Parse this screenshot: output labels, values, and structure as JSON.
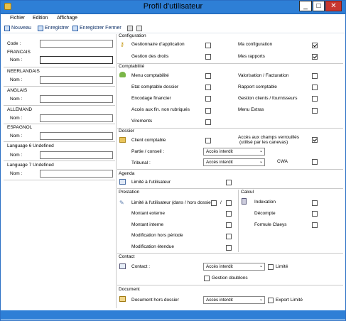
{
  "window": {
    "title": "Profil d'utilisateur",
    "controls": {
      "minimize": "_",
      "maximize": "□",
      "close": "✕"
    }
  },
  "menu": [
    "Fichier",
    "Edition",
    "Affichage"
  ],
  "toolbar": {
    "new": "Nouveau",
    "save": "Enregistrer",
    "save_close": "Enregistrer Fermer"
  },
  "left": {
    "code_label": "Code :",
    "code_value": "",
    "languages": [
      {
        "name": "FRANCAIS",
        "label": "Nom :",
        "value": ""
      },
      {
        "name": "NEERLANDAIS",
        "label": "Nom :",
        "value": ""
      },
      {
        "name": "ANGLAIS",
        "label": "Nom :",
        "value": ""
      },
      {
        "name": "ALLEMAND",
        "label": "Nom :",
        "value": ""
      },
      {
        "name": "ESPAGNOL",
        "label": "Nom :",
        "value": ""
      },
      {
        "name": "Language 6 Undefined",
        "label": "Nom :",
        "value": ""
      },
      {
        "name": "Language 7 Undefined",
        "label": "Nom :",
        "value": ""
      }
    ]
  },
  "configuration": {
    "title": "Configuration",
    "items": [
      {
        "label": "Gestionnaire d'application",
        "checked": false
      },
      {
        "label": "Gestion des droits",
        "checked": false
      },
      {
        "label": "Ma configuration",
        "checked": true
      },
      {
        "label": "Mes rapports",
        "checked": true
      }
    ]
  },
  "comptabilite": {
    "title": "Comptabilité",
    "items": [
      {
        "label": "Menu comptabilité",
        "checked": false
      },
      {
        "label": "Etat comptable dossier",
        "checked": false
      },
      {
        "label": "Encodage financier",
        "checked": false
      },
      {
        "label": "Accès aux fin. non rubriqués",
        "checked": false
      },
      {
        "label": "Virements",
        "checked": false
      },
      {
        "label": "Valorisation / Facturation",
        "checked": false
      },
      {
        "label": "Rapport comptable",
        "checked": false
      },
      {
        "label": "Gestion clients / fournisseurs",
        "checked": false
      },
      {
        "label": "Menu Extras",
        "checked": false
      }
    ]
  },
  "dossier": {
    "title": "Dossier",
    "client_label": "Client comptable",
    "client_checked": false,
    "partie_label": "Partie / conseil :",
    "partie_value": "Accès interdit",
    "tribunal_label": "Tribunal :",
    "tribunal_value": "Accès interdit",
    "verrouille_label": "Accès aux champs verrouillés",
    "verrouille_sub": "(utilisé par les canevas)",
    "verrouille_checked": true,
    "cwa_label": "CWA",
    "cwa_checked": false
  },
  "agenda": {
    "title": "Agenda",
    "label": "Limité à l'utilisateur",
    "checked": false
  },
  "prestation": {
    "title": "Prestation",
    "limite_label": "Limité à l'utilisateur (dans / hors dossier)",
    "slash": "/",
    "items": [
      {
        "label": "Montant externe",
        "checked": false
      },
      {
        "label": "Montant interne",
        "checked": false
      },
      {
        "label": "Modification hors période",
        "checked": false
      },
      {
        "label": "Modification étendue",
        "checked": false
      }
    ]
  },
  "calcul": {
    "title": "Calcul",
    "items": [
      {
        "label": "Indexation",
        "checked": false
      },
      {
        "label": "Décompte",
        "checked": false
      },
      {
        "label": "Formule Claeys",
        "checked": false
      }
    ]
  },
  "contact": {
    "title": "Contact",
    "label": "Contact :",
    "value": "Accès interdit",
    "limite_label": "Limité",
    "doublons_label": "Gestion doublons"
  },
  "document": {
    "title": "Document",
    "label": "Document hors dossier",
    "value": "Accès interdit",
    "export_label": "Export Limité"
  }
}
